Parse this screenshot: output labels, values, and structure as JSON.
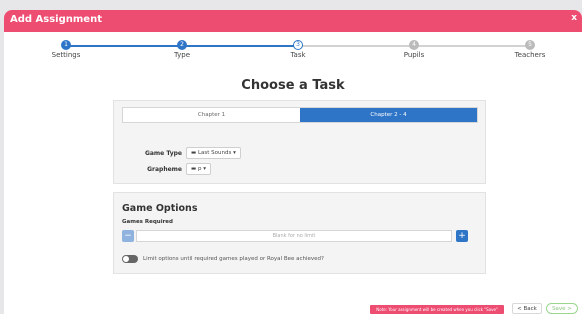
{
  "window": {
    "title": "Add Assignment",
    "close_label": "x"
  },
  "steps": [
    {
      "num": "1",
      "label": "Settings",
      "state": "done"
    },
    {
      "num": "2",
      "label": "Type",
      "state": "done"
    },
    {
      "num": "3",
      "label": "Task",
      "state": "active"
    },
    {
      "num": "4",
      "label": "Pupils",
      "state": "pending"
    },
    {
      "num": "5",
      "label": "Teachers",
      "state": "pending"
    }
  ],
  "heading": "Choose a Task",
  "chapter_toggle": {
    "options": [
      "Chapter 1",
      "Chapter 2 - 4"
    ],
    "selected_index": 1
  },
  "game_type": {
    "label": "Game Type",
    "value": "Last Sounds"
  },
  "grapheme": {
    "label": "Grapheme",
    "value": "p"
  },
  "game_options": {
    "title": "Game Options",
    "games_required_label": "Games Required",
    "placeholder": "Blank for no limit",
    "minus_label": "−",
    "plus_label": "+",
    "limit_toggle_label": "Limit options until required games played or Royal Bee achieved?"
  },
  "footer": {
    "note": "Note: Your assignment will be created when you click \"Save\"",
    "back_label": "< Back",
    "save_label": "Save >"
  },
  "colors": {
    "accent": "#ee4d72",
    "primary": "#2f75c7",
    "save": "#8cc77f"
  }
}
